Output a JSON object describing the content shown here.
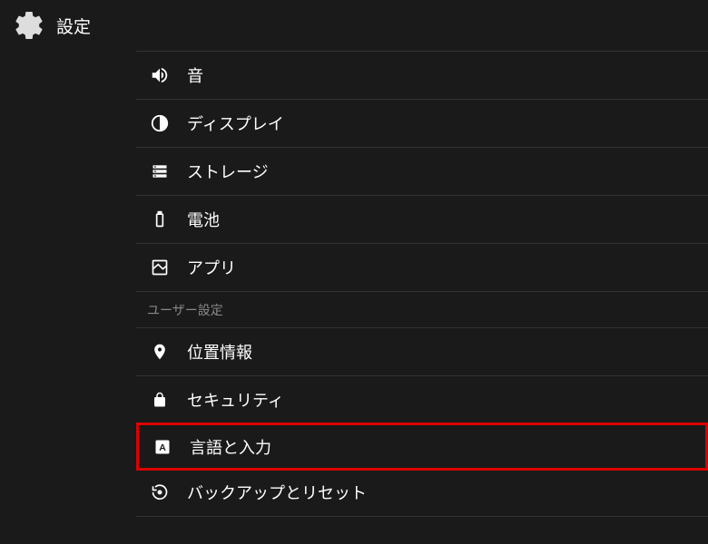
{
  "header": {
    "title": "設定"
  },
  "items": [
    {
      "label": "音"
    },
    {
      "label": "ディスプレイ"
    },
    {
      "label": "ストレージ"
    },
    {
      "label": "電池"
    },
    {
      "label": "アプリ"
    }
  ],
  "category": {
    "label": "ユーザー設定"
  },
  "userItems": [
    {
      "label": "位置情報"
    },
    {
      "label": "セキュリティ"
    },
    {
      "label": "言語と入力"
    },
    {
      "label": "バックアップとリセット"
    }
  ]
}
